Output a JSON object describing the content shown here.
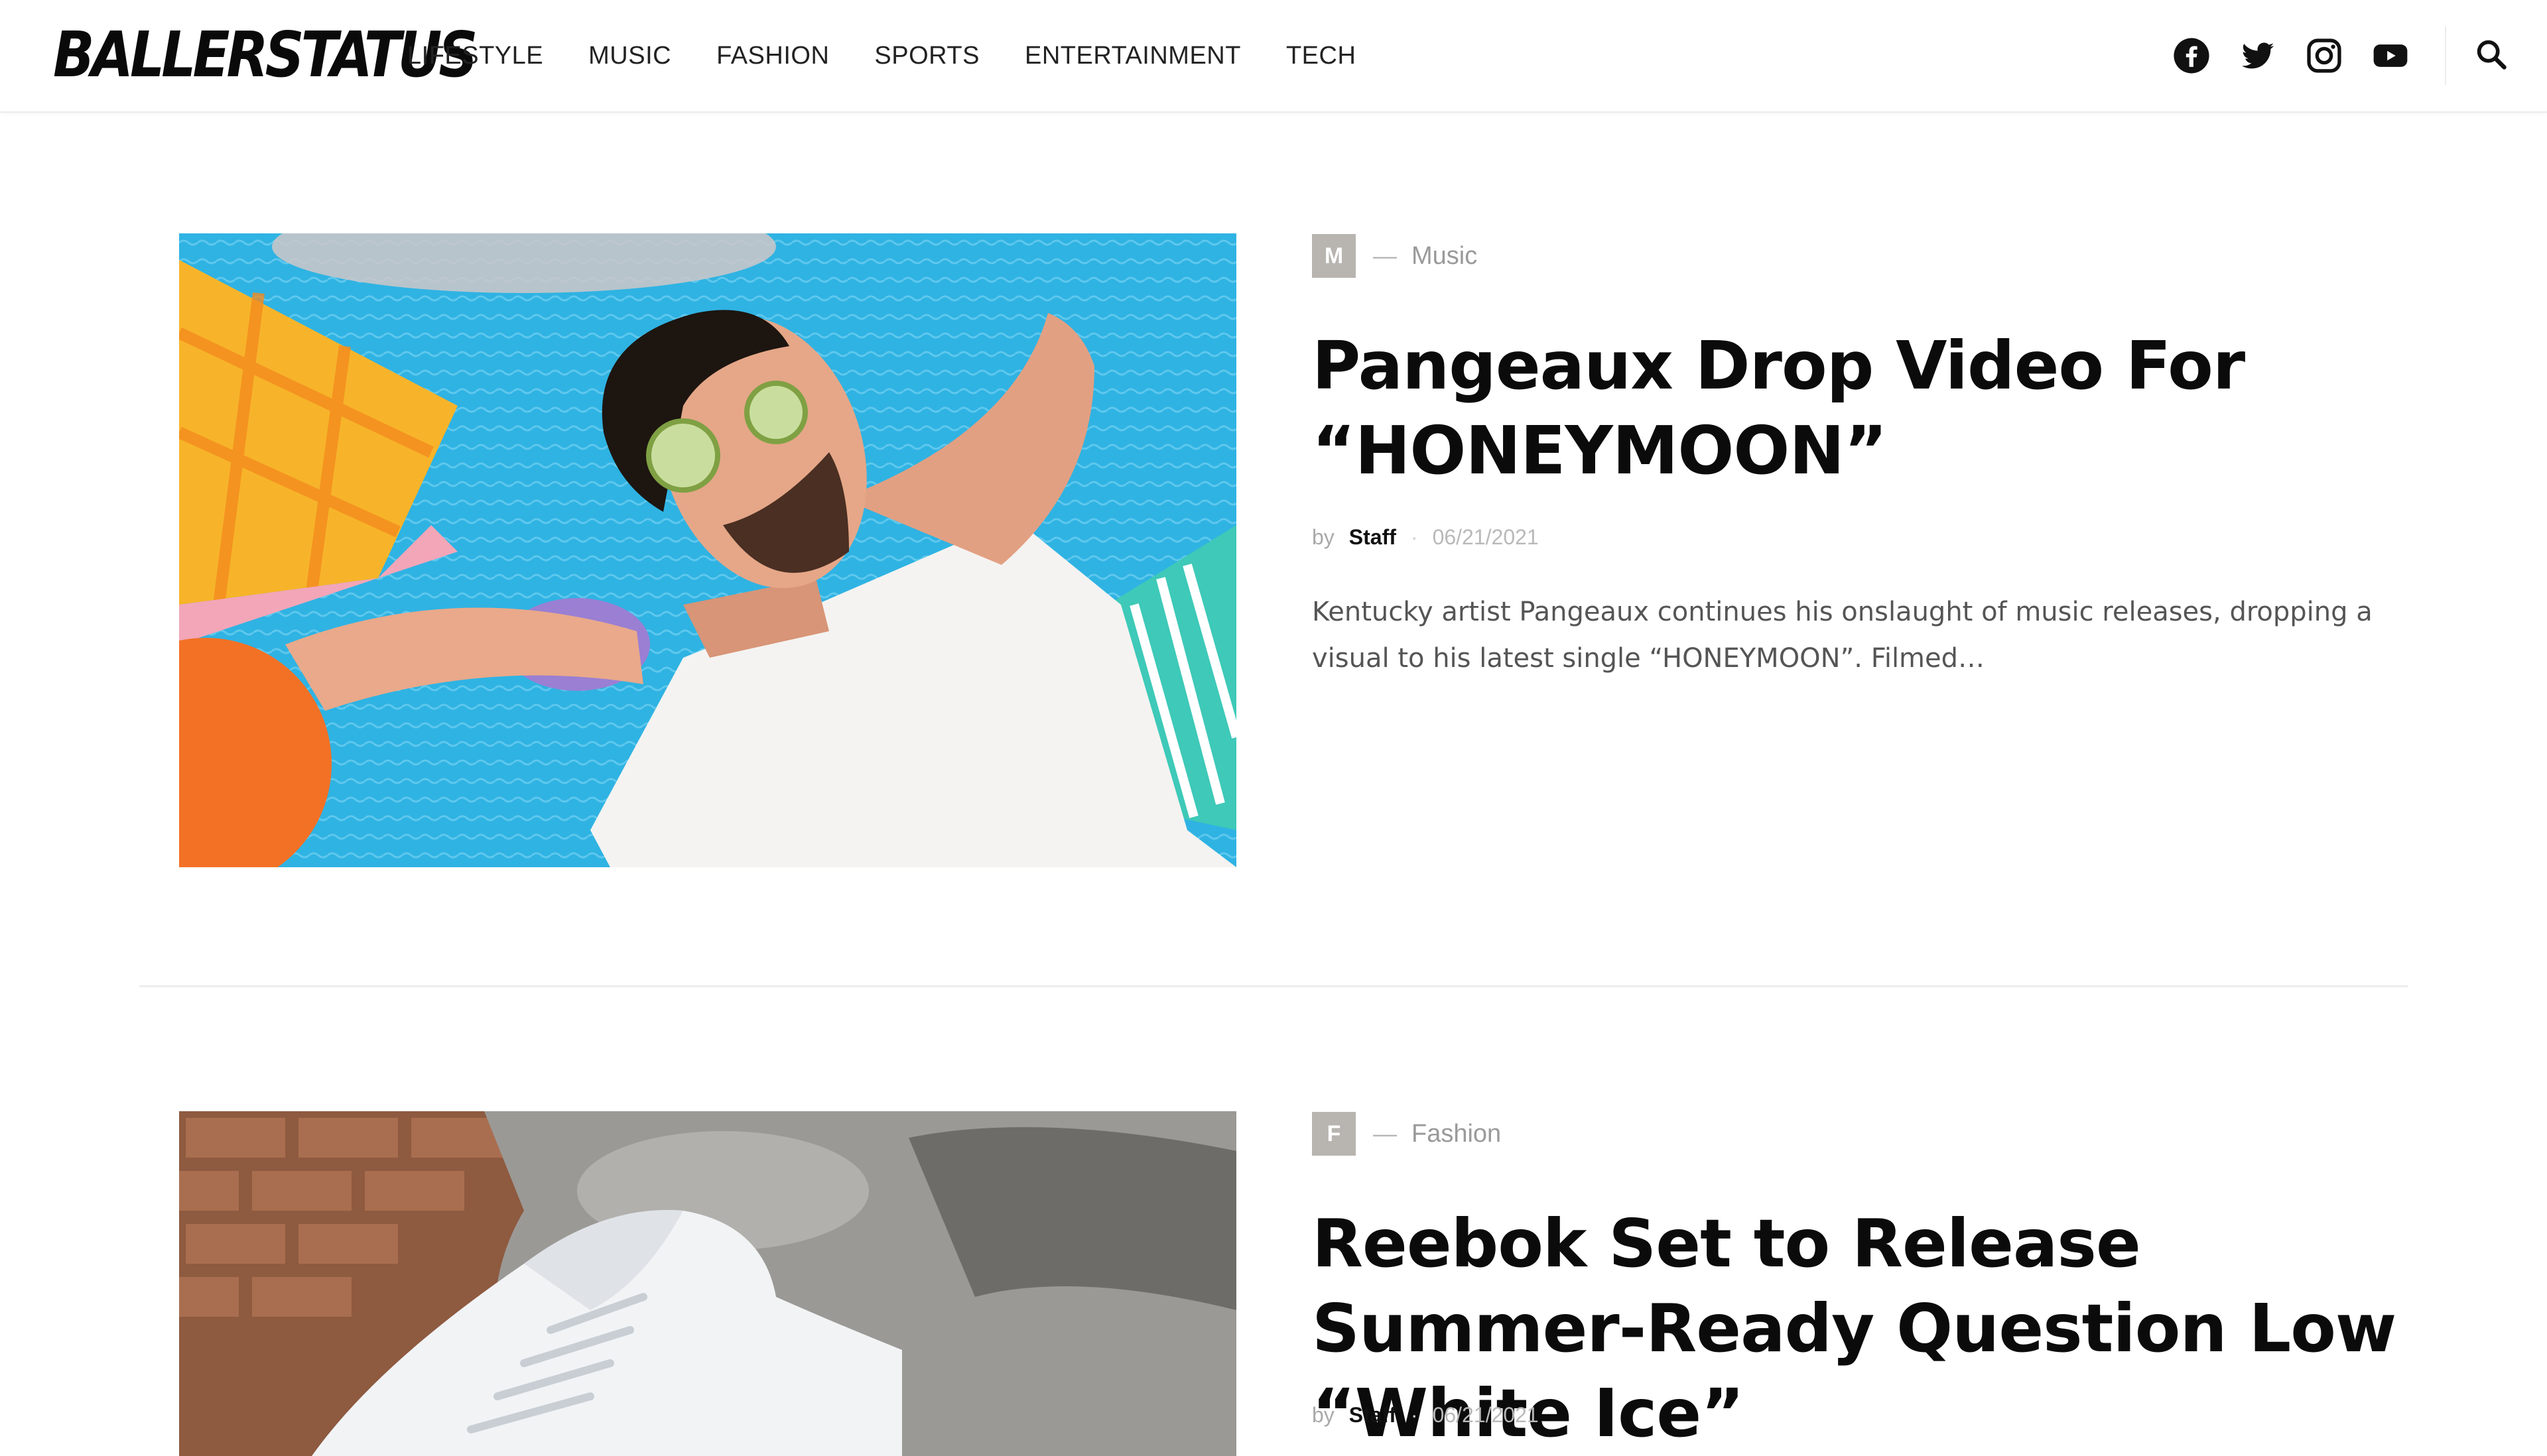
{
  "header": {
    "logo": "BALLERSTATUS",
    "nav": [
      "LIFESTYLE",
      "MUSIC",
      "FASHION",
      "SPORTS",
      "ENTERTAINMENT",
      "TECH"
    ],
    "social": [
      "facebook-icon",
      "twitter-icon",
      "instagram-icon",
      "youtube-icon"
    ],
    "search_icon": "search-icon"
  },
  "articles": [
    {
      "badge": "M",
      "dash": "—",
      "category": "Music",
      "title": "Pangeaux Drop Video For “HONEYMOON”",
      "by": "by",
      "author": "Staff",
      "sep": "·",
      "date": "06/21/2021",
      "excerpt": "Kentucky artist Pangeaux continues his onslaught of music releases, dropping a visual to his latest single “HONEYMOON”. Filmed…"
    },
    {
      "badge": "F",
      "dash": "—",
      "category": "Fashion",
      "title": "Reebok Set to Release Summer-Ready Question Low “White Ice”",
      "by": "by",
      "author": "Staff",
      "sep": "·",
      "date": "06/21/2021"
    }
  ]
}
